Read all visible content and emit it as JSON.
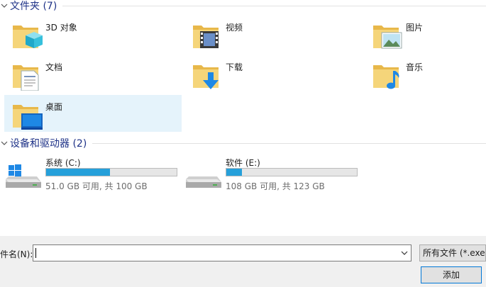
{
  "folders_group": {
    "title": "文件夹 (7)"
  },
  "folders": [
    {
      "name": "3D 对象",
      "icon": "3d-objects-folder-icon"
    },
    {
      "name": "视频",
      "icon": "videos-folder-icon"
    },
    {
      "name": "图片",
      "icon": "pictures-folder-icon"
    },
    {
      "name": "文档",
      "icon": "documents-folder-icon"
    },
    {
      "name": "下载",
      "icon": "downloads-folder-icon"
    },
    {
      "name": "音乐",
      "icon": "music-folder-icon"
    },
    {
      "name": "桌面",
      "icon": "desktop-folder-icon",
      "selected": true
    }
  ],
  "drives_group": {
    "title": "设备和驱动器 (2)"
  },
  "drives": [
    {
      "name": "系统 (C:)",
      "space": "51.0 GB 可用, 共 100 GB",
      "used_fraction": 0.49,
      "icon": "windows-drive-icon"
    },
    {
      "name": "软件 (E:)",
      "space": "108 GB 可用, 共 123 GB",
      "used_fraction": 0.122,
      "icon": "drive-icon"
    }
  ],
  "bottom": {
    "filename_label": "件名(N):",
    "filename_value": "",
    "filter_label": "所有文件 (*.exe)",
    "add_button": "添加"
  },
  "colors": {
    "accent": "#0078d7",
    "bar_fill": "#26a0da",
    "header_text": "#1e3287",
    "selection": "#e5f3fb"
  }
}
